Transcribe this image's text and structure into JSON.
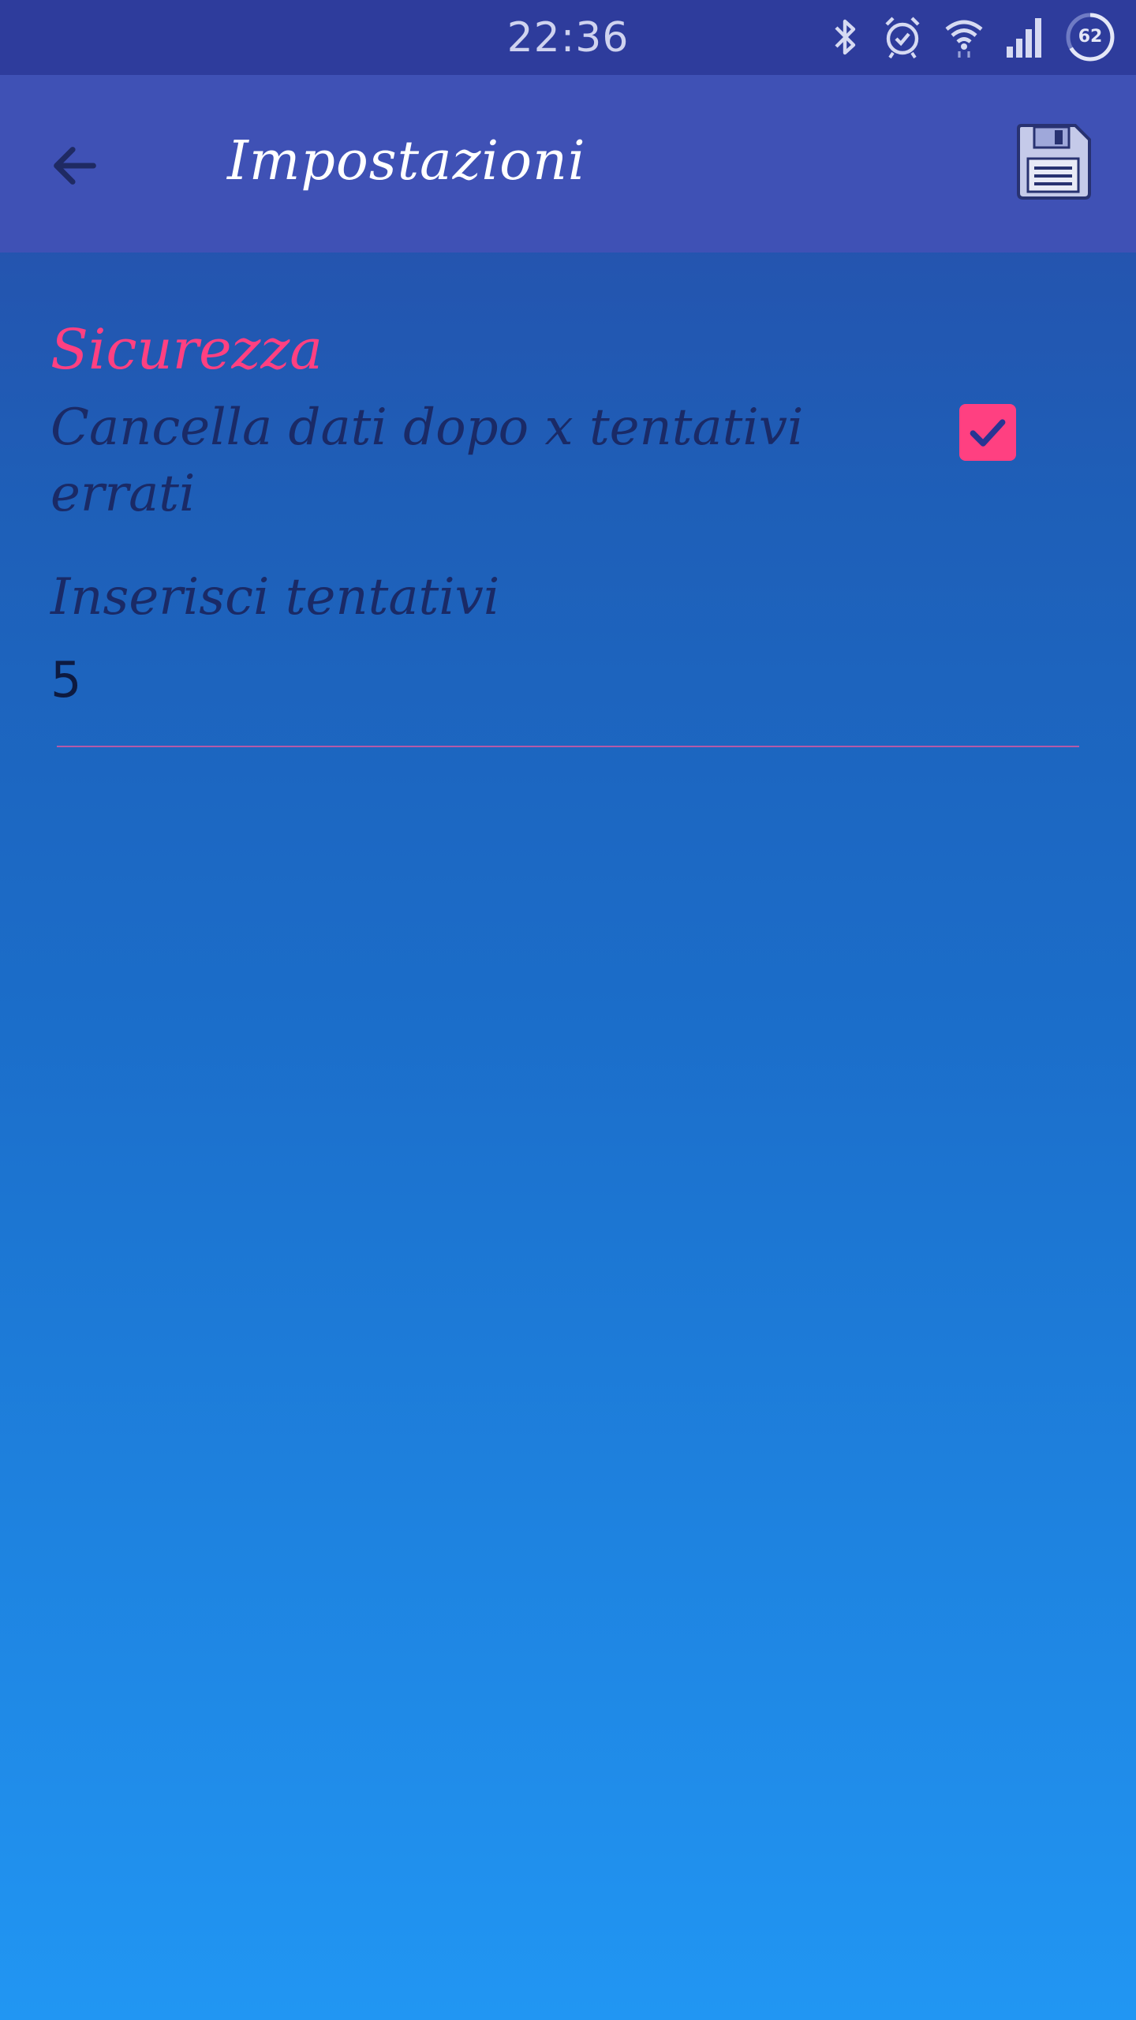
{
  "status_bar": {
    "time": "22:36",
    "battery": "62",
    "icons": [
      "bluetooth-icon",
      "alarm-icon",
      "wifi-icon",
      "signal-icon",
      "battery-icon"
    ]
  },
  "app_bar": {
    "title": "Impostazioni",
    "back_icon": "arrow-back-icon",
    "save_icon": "floppy-disk-icon",
    "background": "#3f51b5"
  },
  "settings": {
    "section_title": "Sicurezza",
    "wipe_option": {
      "label": "Cancella dati dopo x tentativi errati",
      "checked": true
    },
    "attempts_field": {
      "label": "Inserisci tentativi",
      "value": "5"
    }
  },
  "colors": {
    "accent": "#ff4081",
    "status_bar": "#2e3c9c",
    "primary": "#3f51b5",
    "text_dark": "#1a2a66"
  }
}
